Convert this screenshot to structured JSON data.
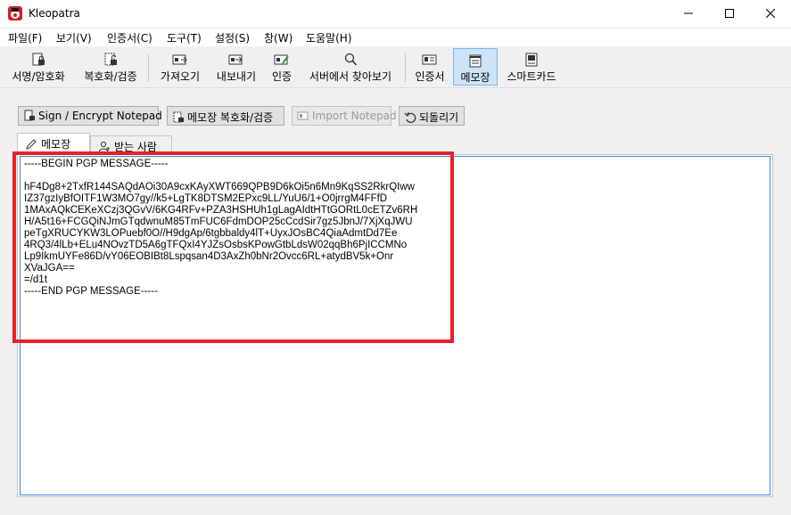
{
  "window": {
    "title": "Kleopatra",
    "accent_color": "#0078d7"
  },
  "menu": [
    {
      "label": "파일(F)",
      "name": "menu-file"
    },
    {
      "label": "보기(V)",
      "name": "menu-view"
    },
    {
      "label": "인증서(C)",
      "name": "menu-certificates"
    },
    {
      "label": "도구(T)",
      "name": "menu-tools"
    },
    {
      "label": "설정(S)",
      "name": "menu-settings"
    },
    {
      "label": "창(W)",
      "name": "menu-window"
    },
    {
      "label": "도움말(H)",
      "name": "menu-help"
    }
  ],
  "toolbar": {
    "sign_encrypt": "서명/암호화",
    "decrypt_verify": "복호화/검증",
    "import": "가져오기",
    "export": "내보내기",
    "certify": "인증",
    "lookup_server": "서버에서 찾아보기",
    "certificates": "인증서",
    "notepad": "메모장",
    "smartcards": "스마트카드"
  },
  "notepad_actions": {
    "sign_encrypt": "Sign / Encrypt Notepad",
    "decrypt_verify": "메모장 복호화/검증",
    "import": "Import Notepad",
    "revert": "되돌리기"
  },
  "tabs": {
    "notepad": "메모장",
    "recipients": "받는 사람"
  },
  "notepad_text": "-----BEGIN PGP MESSAGE-----\n\nhF4Dg8+2TxfR144SAQdAOi30A9cxKAyXWT669QPB9D6kOi5n6Mn9KqSS2RkrQIww\nIZ37gzIyBfOITF1W3MO7gy//k5+LgTK8DTSM2EPxc9LL/YuU6/1+O0jrrgM4FFfD\n1MAxAQkCEKeXCzj3QGvV/6KG4RFv+PZA3HSHUh1gLagAIdtHTtGORtL0cETZv6RH\nH/A5t16+FCGQiNJmGTqdwnuM85TmFUC6FdmDOP25cCcdSir7gz5JbnJ/7XjXqJWU\npeTgXRUCYKW3LOPuebf0O//H9dgAp/6tgbbaldy4lT+UyxJOsBC4QiaAdmtDd7Ee\n4RQ3/4lLb+ELu4NOvzTD5A6gTFQxI4YJZsOsbsKPowGtbLdsW02qqBh6PjICCMNo\nLp9IkmUYFe86D/vY06EOBIBt8Lspqsan4D3AxZh0bNr2Ovcc6RL+atydBV5k+Onr\nXVaJGA==\n=/d1t\n-----END PGP MESSAGE-----"
}
